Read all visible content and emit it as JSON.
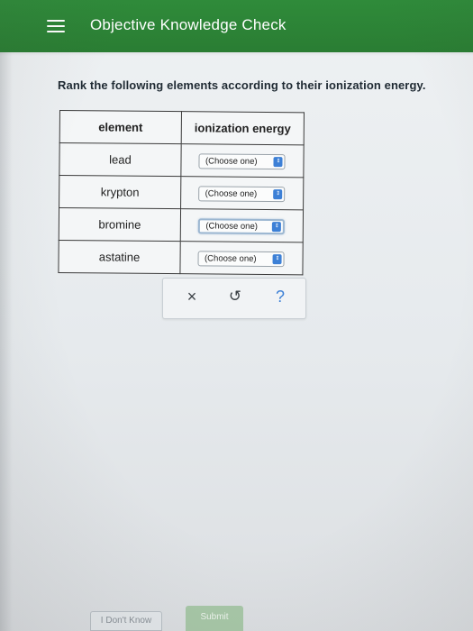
{
  "header": {
    "title": "Objective Knowledge Check",
    "menu_icon": "hamburger-menu-icon"
  },
  "question": {
    "text": "Rank the following elements according to their ionization energy."
  },
  "table": {
    "columns": [
      "element",
      "ionization energy"
    ],
    "rows": [
      {
        "element": "lead",
        "selection": "(Choose one)"
      },
      {
        "element": "krypton",
        "selection": "(Choose one)"
      },
      {
        "element": "bromine",
        "selection": "(Choose one)"
      },
      {
        "element": "astatine",
        "selection": "(Choose one)"
      }
    ]
  },
  "actions": {
    "clear_symbol": "×",
    "undo_symbol": "↺",
    "help_symbol": "?"
  },
  "footer": {
    "dont_know_label": "I Don't Know",
    "submit_label": "Submit"
  },
  "colors": {
    "header_green": "#2a7d33",
    "accent_blue": "#3d80d6",
    "submit_green": "#a8c8a8"
  }
}
